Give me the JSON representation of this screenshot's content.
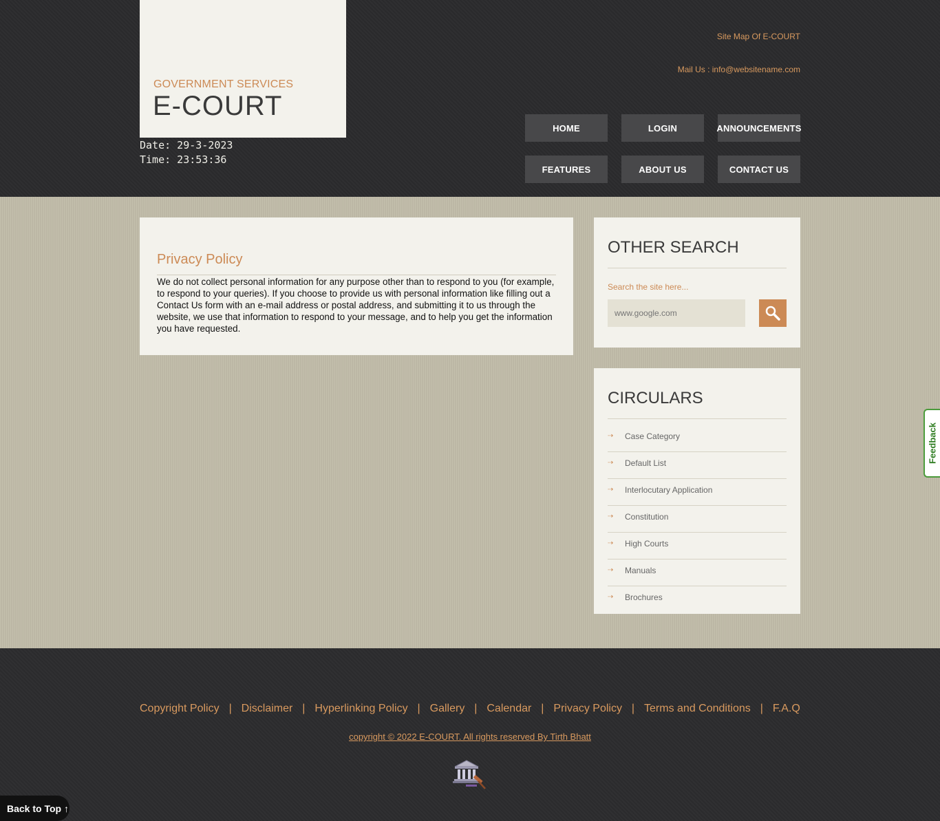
{
  "header": {
    "logo_subtitle": "GOVERNMENT SERVICES",
    "logo_title": "E-COURT",
    "date": "Date: 29-3-2023",
    "time": "Time: 23:53:36",
    "sitemap_link": "Site Map Of E-COURT",
    "mail_link": "Mail Us : info@websitename.com",
    "nav": [
      "HOME",
      "LOGIN",
      "ANNOUNCEMENTS",
      "FEATURES",
      "ABOUT US",
      "CONTACT US"
    ]
  },
  "content": {
    "title": "Privacy Policy",
    "body": "We do not collect personal information for any purpose other than to respond to you (for example, to respond to your queries). If you choose to provide us with personal information like filling out a Contact Us form with an e-mail address or postal address, and submitting it to us through the website, we use that information to respond to your message, and to help you get the information you have requested."
  },
  "sidebar": {
    "search": {
      "title": "OTHER SEARCH",
      "label": "Search the site here...",
      "placeholder": "www.google.com"
    },
    "circulars": {
      "title": "CIRCULARS",
      "items": [
        "Case Category",
        "Default List",
        "Interlocutary Application",
        "Constitution",
        "High Courts",
        "Manuals",
        "Brochures"
      ]
    }
  },
  "footer": {
    "links": [
      "Copyright Policy",
      "Disclaimer",
      "Hyperlinking Policy",
      "Gallery",
      "Calendar",
      "Privacy Policy",
      "Terms and Conditions",
      "F.A.Q"
    ],
    "separator": "|",
    "copyright": "copyright © 2022 E-COURT. All rights reserved By Tirth Bhatt"
  },
  "widgets": {
    "back_to_top": "Back to Top ↑",
    "feedback": "Feedback"
  },
  "colors": {
    "accent": "#cc8a55",
    "dark_bg": "#2c2c2e",
    "main_bg": "#c2bdaa",
    "panel_bg": "#f3f2ec",
    "nav_btn": "#48484a"
  }
}
